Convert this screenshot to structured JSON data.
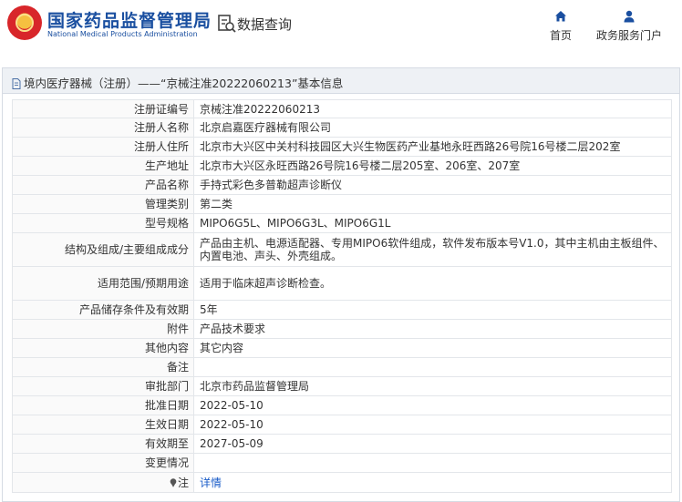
{
  "header": {
    "org_title": "国家药品监督管理局",
    "org_subtitle": "National Medical Products Administration",
    "query_label": "数据查询",
    "nav": [
      {
        "label": "首页",
        "icon": "home-icon"
      },
      {
        "label": "政务服务门户",
        "icon": "user-icon"
      }
    ]
  },
  "section": {
    "title": "境内医疗器械（注册）——“京械注准20222060213”基本信息"
  },
  "table": {
    "rows": [
      {
        "label": "注册证编号",
        "value": "京械注准20222060213"
      },
      {
        "label": "注册人名称",
        "value": "北京启嘉医疗器械有限公司"
      },
      {
        "label": "注册人住所",
        "value": "北京市大兴区中关村科技园区大兴生物医药产业基地永旺西路26号院16号楼二层202室"
      },
      {
        "label": "生产地址",
        "value": "北京市大兴区永旺西路26号院16号楼二层205室、206室、207室"
      },
      {
        "label": "产品名称",
        "value": "手持式彩色多普勒超声诊断仪"
      },
      {
        "label": "管理类别",
        "value": "第二类"
      },
      {
        "label": "型号规格",
        "value": "MIPO6G5L、MIPO6G3L、MIPO6G1L"
      },
      {
        "label": "结构及组成/主要组成成分",
        "value": "产品由主机、电源适配器、专用MIPO6软件组成，软件发布版本号V1.0，其中主机由主板组件、内置电池、声头、外壳组成。"
      },
      {
        "label": "适用范围/预期用途",
        "value": "适用于临床超声诊断检查。"
      },
      {
        "label": "产品储存条件及有效期",
        "value": "5年"
      },
      {
        "label": "附件",
        "value": "产品技术要求"
      },
      {
        "label": "其他内容",
        "value": "其它内容"
      },
      {
        "label": "备注",
        "value": ""
      },
      {
        "label": "审批部门",
        "value": "北京市药品监督管理局"
      },
      {
        "label": "批准日期",
        "value": "2022-05-10"
      },
      {
        "label": "生效日期",
        "value": "2022-05-10"
      },
      {
        "label": "有效期至",
        "value": "2027-05-09"
      },
      {
        "label": "变更情况",
        "value": ""
      }
    ],
    "note": {
      "label": "注",
      "link": "详情"
    }
  }
}
